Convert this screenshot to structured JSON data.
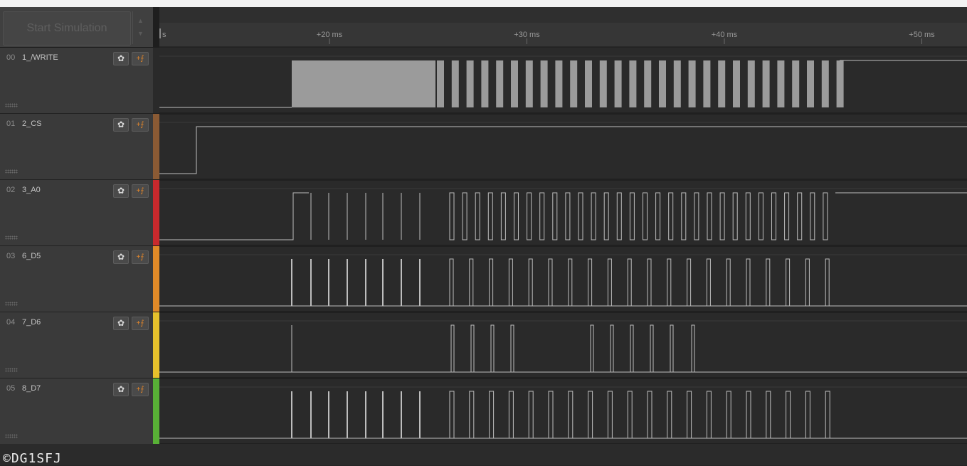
{
  "sim": {
    "label": "Start Simulation",
    "up_icon": "▲",
    "down_icon": "▼"
  },
  "timeline": {
    "start_label": "s",
    "marks": [
      {
        "label": "+20 ms",
        "ms": 20
      },
      {
        "label": "+30 ms",
        "ms": 30
      },
      {
        "label": "+40 ms",
        "ms": 40
      },
      {
        "label": "+50 ms",
        "ms": 50
      }
    ]
  },
  "channels": [
    {
      "id": "00",
      "name": "1_/WRITE",
      "color": "#2a2a2a"
    },
    {
      "id": "01",
      "name": "2_CS",
      "color": "#8a5a34"
    },
    {
      "id": "02",
      "name": "3_A0",
      "color": "#c8292d"
    },
    {
      "id": "03",
      "name": "6_D5",
      "color": "#e08a28"
    },
    {
      "id": "04",
      "name": "7_D6",
      "color": "#e6c12c"
    },
    {
      "id": "05",
      "name": "8_D7",
      "color": "#58b036"
    }
  ],
  "icons": {
    "gear": "gear-icon",
    "trigger": "trigger-edge-icon"
  },
  "gear_glyph": "✿",
  "trigger_glyph": "+⨍",
  "watermark": "©DG1SFJ"
}
